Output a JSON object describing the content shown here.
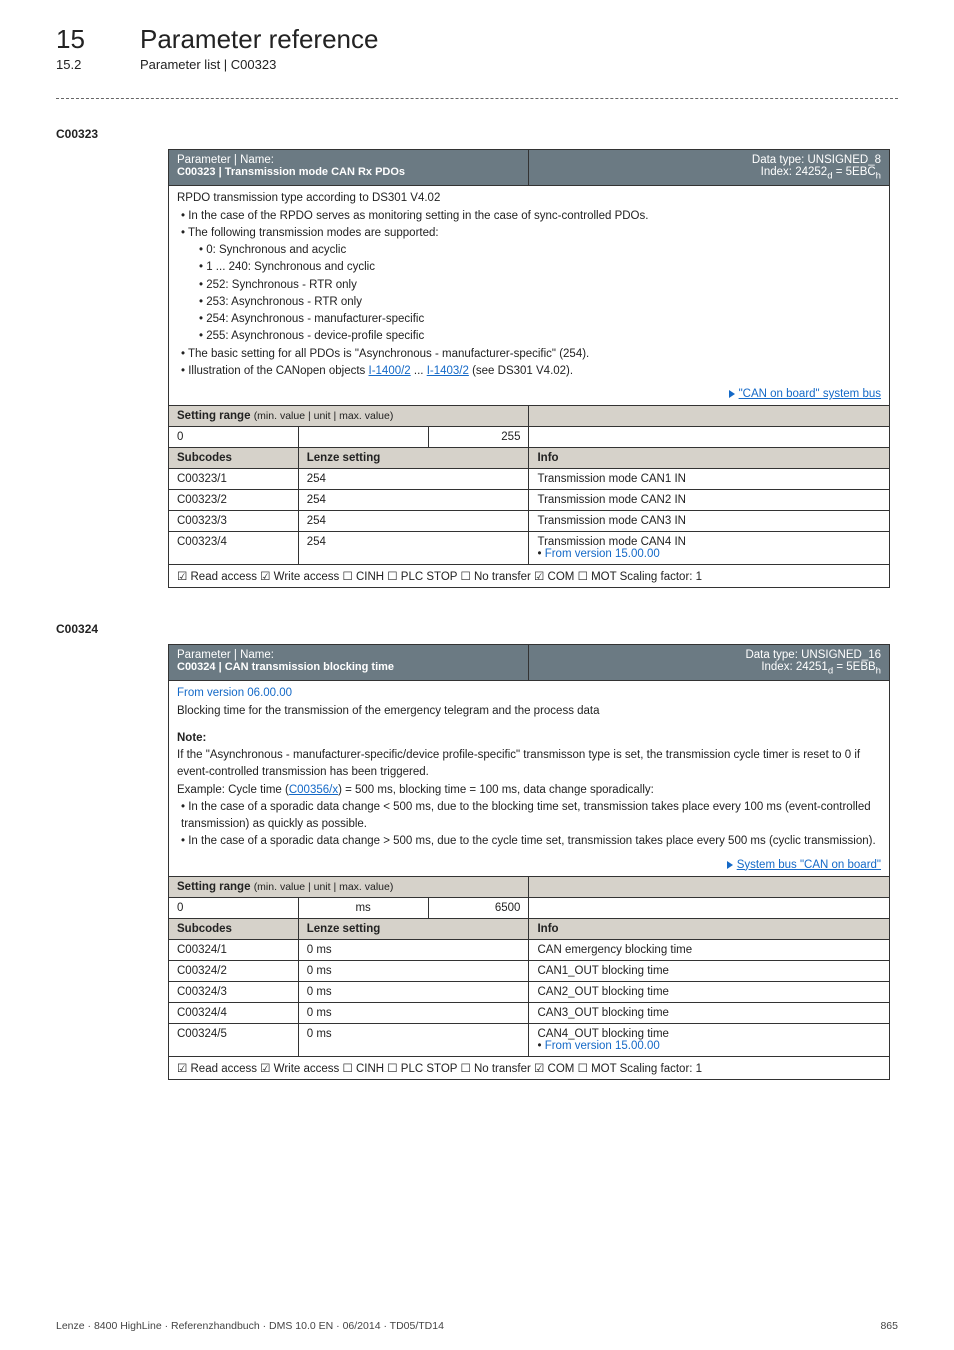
{
  "chapter": {
    "num": "15",
    "title": "Parameter reference"
  },
  "section": {
    "num": "15.2",
    "title": "Parameter list | C00323"
  },
  "p1": {
    "code": "C00323",
    "hdr_left_label": "Parameter | Name:",
    "hdr_title": "C00323 | Transmission mode CAN Rx PDOs",
    "hdr_right_l1": "Data type: UNSIGNED_8",
    "hdr_right_l2": "Index: 24252",
    "hdr_right_l2_sub1": "d",
    "hdr_right_l2_mid": " = 5EBC",
    "hdr_right_l2_sub2": "h",
    "desc": {
      "line1": "RPDO transmission type according to DS301 V4.02",
      "b1": "• In the case of the RPDO serves as monitoring setting in the case of sync-controlled PDOs.",
      "b2": "• The following transmission modes are supported:",
      "b2a": "• 0: Synchronous and acyclic",
      "b2b": "• 1 ... 240: Synchronous and cyclic",
      "b2c": "• 252: Synchronous - RTR only",
      "b2d": "• 253: Asynchronous - RTR only",
      "b2e": "• 254: Asynchronous - manufacturer-specific",
      "b2f": "• 255: Asynchronous - device-profile specific",
      "b3": "• The basic setting for all PDOs is \"Asynchronous - manufacturer-specific\" (254).",
      "b4_pre": "• Illustration of the CANopen objects ",
      "b4_link1": "I-1400/2",
      "b4_mid": "  ... ",
      "b4_link2": "I-1403/2",
      "b4_post": "  (see DS301 V4.02).",
      "syslink": "\"CAN on board\" system bus"
    },
    "range_label": "Setting range ",
    "range_sublabel": "(min. value | unit | max. value)",
    "range_min": "0",
    "range_unit": "",
    "range_max": "255",
    "sub_hdr_l": "Subcodes",
    "sub_hdr_m": "Lenze setting",
    "sub_hdr_r": "Info",
    "rows": [
      {
        "c": "C00323/1",
        "s": "254",
        "i": "Transmission mode CAN1 IN"
      },
      {
        "c": "C00323/2",
        "s": "254",
        "i": "Transmission mode CAN2 IN"
      },
      {
        "c": "C00323/3",
        "s": "254",
        "i": "Transmission mode CAN3 IN"
      },
      {
        "c": "C00323/4",
        "s": "254",
        "i": "Transmission mode CAN4 IN",
        "extra": "• ",
        "extra_link": "From version 15.00.00"
      }
    ],
    "footer": "☑ Read access   ☑ Write access   ☐ CINH   ☐ PLC STOP   ☐ No transfer   ☑ COM   ☐ MOT    Scaling factor: 1"
  },
  "p2": {
    "code": "C00324",
    "hdr_left_label": "Parameter | Name:",
    "hdr_title": "C00324 | CAN transmission blocking time",
    "hdr_right_l1": "Data type: UNSIGNED_16",
    "hdr_right_l2": "Index: 24251",
    "hdr_right_l2_sub1": "d",
    "hdr_right_l2_mid": " = 5EBB",
    "hdr_right_l2_sub2": "h",
    "from_ver": "From version 06.00.00",
    "line1": "Blocking time for the transmission of the emergency telegram and the process data",
    "note_label": "Note:",
    "note_l1": "If the \"Asynchronous - manufacturer-specific/device profile-specific\" transmisson type is set, the transmission cycle timer is reset to 0 if event-controlled transmission has been triggered.",
    "note_l2_pre": "Example: Cycle time (",
    "note_l2_link": "C00356/x",
    "note_l2_post": ") = 500 ms, blocking time = 100 ms, data change sporadically:",
    "note_b1": "• In the case of a sporadic data change < 500 ms, due to the blocking time set, transmission takes place every 100 ms (event-controlled transmission) as quickly as possible.",
    "note_b2": "• In the case of a sporadic data change > 500 ms, due to the cycle time set, transmission takes place every 500 ms (cyclic transmission).",
    "syslink": "System bus \"CAN on board\"",
    "range_label": "Setting range ",
    "range_sublabel": "(min. value | unit | max. value)",
    "range_min": "0",
    "range_unit": "ms",
    "range_max": "6500",
    "sub_hdr_l": "Subcodes",
    "sub_hdr_m": "Lenze setting",
    "sub_hdr_r": "Info",
    "rows": [
      {
        "c": "C00324/1",
        "s": "0 ms",
        "i": "CAN emergency blocking time"
      },
      {
        "c": "C00324/2",
        "s": "0 ms",
        "i": "CAN1_OUT blocking time"
      },
      {
        "c": "C00324/3",
        "s": "0 ms",
        "i": "CAN2_OUT blocking time"
      },
      {
        "c": "C00324/4",
        "s": "0 ms",
        "i": "CAN3_OUT blocking time"
      },
      {
        "c": "C00324/5",
        "s": "0 ms",
        "i": "CAN4_OUT blocking time",
        "extra": "• ",
        "extra_link": "From version 15.00.00"
      }
    ],
    "footer": "☑ Read access   ☑ Write access   ☐ CINH   ☐ PLC STOP   ☐ No transfer   ☑ COM   ☐ MOT    Scaling factor: 1"
  },
  "footer": {
    "left": "Lenze · 8400 HighLine · Referenzhandbuch · DMS 10.0 EN · 06/2014 · TD05/TD14",
    "right": "865"
  }
}
